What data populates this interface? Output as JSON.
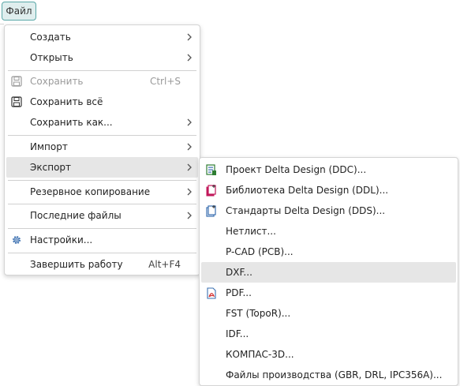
{
  "menubar": {
    "file_label": "Файл"
  },
  "main_menu": {
    "items": [
      {
        "label": "Создать",
        "submenu": true
      },
      {
        "label": "Открыть",
        "submenu": true
      },
      {
        "label": "Сохранить",
        "shortcut": "Ctrl+S",
        "disabled": true,
        "icon": "save-icon"
      },
      {
        "label": "Сохранить всё",
        "icon": "save-all-icon"
      },
      {
        "label": "Сохранить как...",
        "submenu": true
      },
      {
        "label": "Импорт",
        "submenu": true
      },
      {
        "label": "Экспорт",
        "submenu": true,
        "highlighted": true
      },
      {
        "label": "Резервное копирование",
        "submenu": true
      },
      {
        "label": "Последние файлы",
        "submenu": true
      },
      {
        "label": "Настройки...",
        "icon": "gear-icon"
      },
      {
        "label": "Завершить работу",
        "shortcut": "Alt+F4"
      }
    ]
  },
  "export_menu": {
    "items": [
      {
        "label": "Проект Delta Design (DDC)...",
        "icon": "project-icon"
      },
      {
        "label": "Библиотека Delta Design (DDL)...",
        "icon": "library-icon"
      },
      {
        "label": "Стандарты Delta Design (DDS)...",
        "icon": "standards-icon"
      },
      {
        "label": "Нетлист..."
      },
      {
        "label": "P-CAD (PCB)..."
      },
      {
        "label": "DXF...",
        "highlighted": true
      },
      {
        "label": "PDF...",
        "icon": "pdf-icon"
      },
      {
        "label": "FST (TopoR)..."
      },
      {
        "label": "IDF..."
      },
      {
        "label": "КОМПАС-3D..."
      },
      {
        "label": "Файлы производства (GBR, DRL, IPC356A)..."
      }
    ]
  },
  "colors": {
    "accent_teal": "#5aa7a7",
    "highlight": "#e6e6e6",
    "disabled_text": "#9a9a9a",
    "pdf_red": "#d32f2f",
    "icon_blue": "#3a6fb0",
    "icon_pink": "#c2185b"
  }
}
